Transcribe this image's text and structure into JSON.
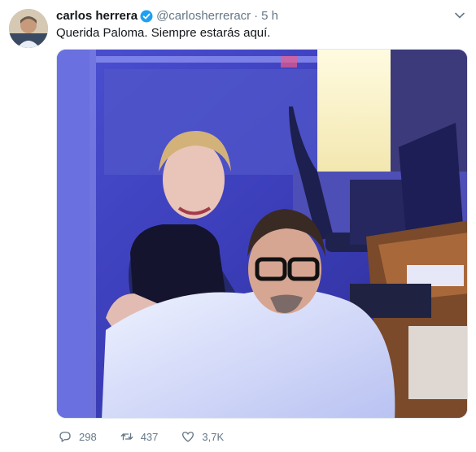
{
  "tweet": {
    "author_name": "carlos herrera",
    "handle": "@carlosherreracr",
    "separator": "·",
    "time": "5 h",
    "text": "Querida Paloma. Siempre estarás aquí.",
    "verified_color": "#1da1f2"
  },
  "actions": {
    "replies": "298",
    "retweets": "437",
    "likes": "3,7K"
  },
  "icons": [
    "verified-badge-icon",
    "chevron-down-icon",
    "reply-icon",
    "retweet-icon",
    "like-icon"
  ]
}
